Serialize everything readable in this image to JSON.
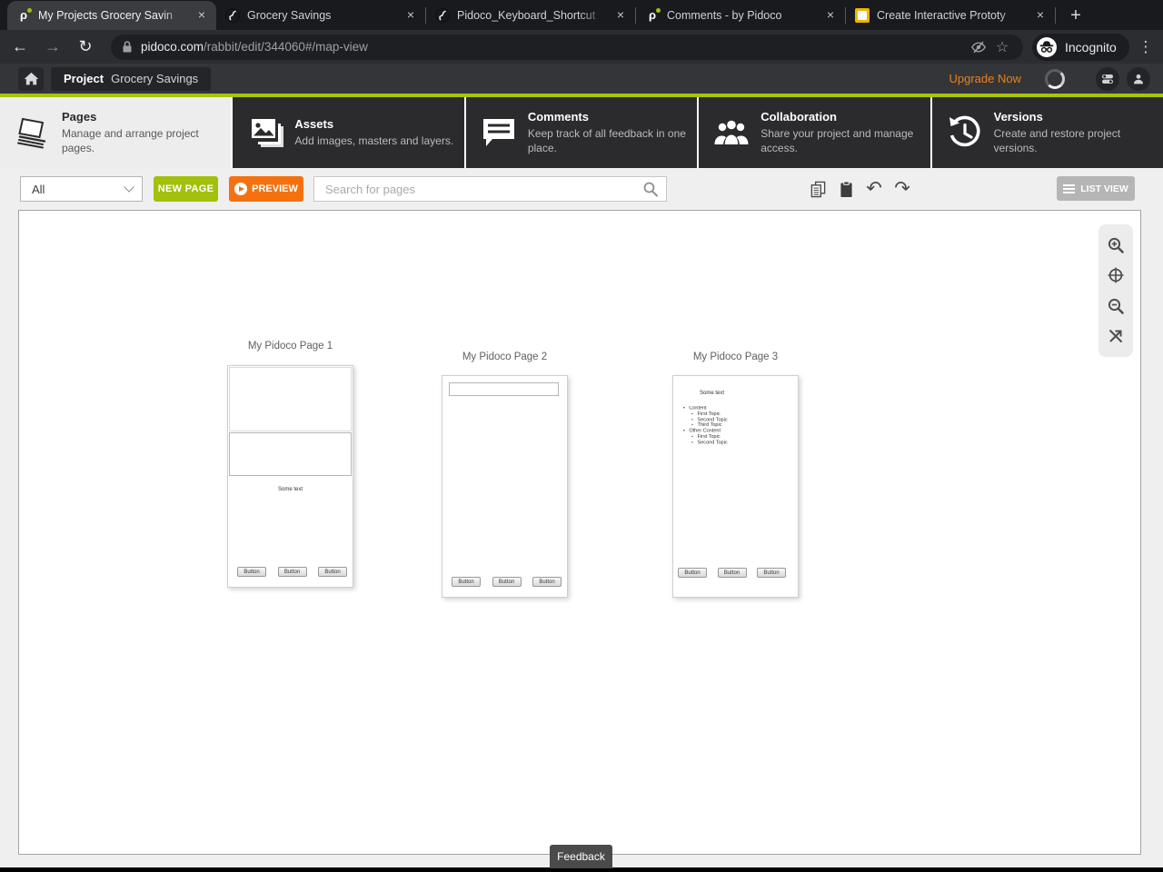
{
  "browser": {
    "tabs": [
      {
        "title": "My Projects Grocery Savin",
        "favicon": "pidoco",
        "active": true
      },
      {
        "title": "Grocery Savings",
        "favicon": "globe-dark",
        "active": false
      },
      {
        "title": "Pidoco_Keyboard_Shortcut",
        "favicon": "globe-dark",
        "active": false
      },
      {
        "title": "Comments - by Pidoco",
        "favicon": "pidoco",
        "active": false
      },
      {
        "title": "Create Interactive Prototy",
        "favicon": "yellow-square",
        "active": false
      }
    ],
    "url": {
      "domain": "pidoco.com",
      "path": "/rabbit/edit/344060#/map-view"
    },
    "incognito_label": "Incognito"
  },
  "icons": {
    "close": "×",
    "new_tab": "+",
    "back": "←",
    "forward": "→",
    "reload": "↻",
    "star": "☆",
    "menu": "⋮",
    "undo": "↶",
    "redo": "↷"
  },
  "project_bar": {
    "project_label": "Project",
    "project_name": "Grocery Savings",
    "upgrade_label": "Upgrade Now"
  },
  "nav": {
    "sections": [
      {
        "title": "Pages",
        "desc": "Manage and arrange project pages.",
        "active": true
      },
      {
        "title": "Assets",
        "desc": "Add images, masters and layers.",
        "active": false
      },
      {
        "title": "Comments",
        "desc": "Keep track of all feedback in one place.",
        "active": false
      },
      {
        "title": "Collaboration",
        "desc": "Share your project and manage access.",
        "active": false
      },
      {
        "title": "Versions",
        "desc": "Create and restore project versions.",
        "active": false
      }
    ]
  },
  "toolbar": {
    "filter_value": "All",
    "new_page_label": "NEW PAGE",
    "preview_label": "PREVIEW",
    "search_placeholder": "Search for pages",
    "list_view_label": "LIST VIEW"
  },
  "canvas": {
    "pages": [
      {
        "title": "My Pidoco Page 1",
        "some_text": "Some text",
        "buttons": [
          "Button",
          "Button",
          "Button"
        ]
      },
      {
        "title": "My Pidoco Page 2",
        "buttons": [
          "Button",
          "Button",
          "Button"
        ]
      },
      {
        "title": "My Pidoco Page 3",
        "some_text": "Some text",
        "list": [
          {
            "label": "Content",
            "children": [
              "First Topic",
              "Second Topic",
              "Third Topic"
            ]
          },
          {
            "label": "Other Content",
            "children": [
              "First Topic",
              "Second Topic"
            ]
          }
        ],
        "buttons": [
          "Button",
          "Button",
          "Button"
        ]
      }
    ]
  },
  "feedback_label": "Feedback",
  "colors": {
    "accent_green": "#a3c00c",
    "accent_orange": "#f57110",
    "upgrade_orange": "#e8821c",
    "chrome_dark": "#191a1d",
    "nav_dark": "#2b2b2d"
  }
}
